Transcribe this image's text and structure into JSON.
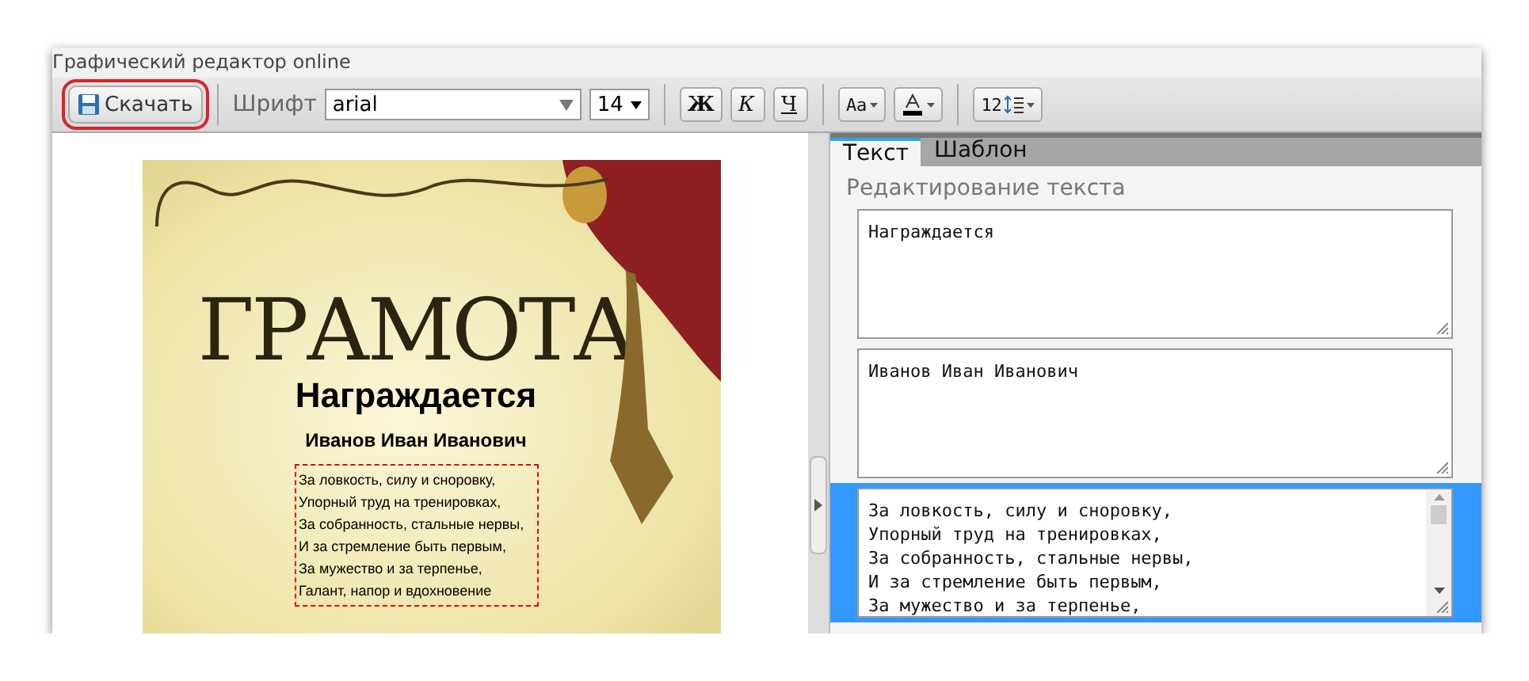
{
  "window": {
    "title": "Графический редактор online"
  },
  "toolbar": {
    "download_button": {
      "label": "Скачать",
      "highlighted": true
    },
    "font_label": "Шрифт",
    "font": {
      "value": "arial"
    },
    "size": {
      "value": "14"
    },
    "style_buttons": [
      {
        "label": "Ж",
        "kind": "bold"
      },
      {
        "label": "К",
        "kind": "italic"
      },
      {
        "label": "Ч",
        "kind": "underline"
      }
    ],
    "case_button": {
      "label": "Aa"
    },
    "spacing_button": {
      "label": "12"
    }
  },
  "canvas": {
    "heading": "ГРАМОТА",
    "title": "Награждается",
    "name": "Иванов Иван Иванович",
    "poem": [
      "За ловкость, силу и сноровку,",
      "Упорный труд на тренировках,",
      "За собранность, стальные нервы,",
      "И за стремление быть первым,",
      "За мужество и за терпенье,",
      "Галант, напор и вдохновение"
    ]
  },
  "panel": {
    "tabs": [
      {
        "label": "Текст",
        "selected": true
      },
      {
        "label": "Шаблон",
        "selected": false
      }
    ],
    "section_title": "Редактирование текста",
    "fields": [
      {
        "lines": [
          "Награждается"
        ],
        "selected": false
      },
      {
        "lines": [
          "Иванов Иван Иванович"
        ],
        "selected": false
      },
      {
        "lines": [
          "За ловкость, силу и сноровку,",
          "Упорный труд на тренировках,",
          "За собранность, стальные нервы,",
          "И за стремление быть первым,",
          "За мужество и за терпенье,"
        ],
        "selected": true
      }
    ]
  }
}
